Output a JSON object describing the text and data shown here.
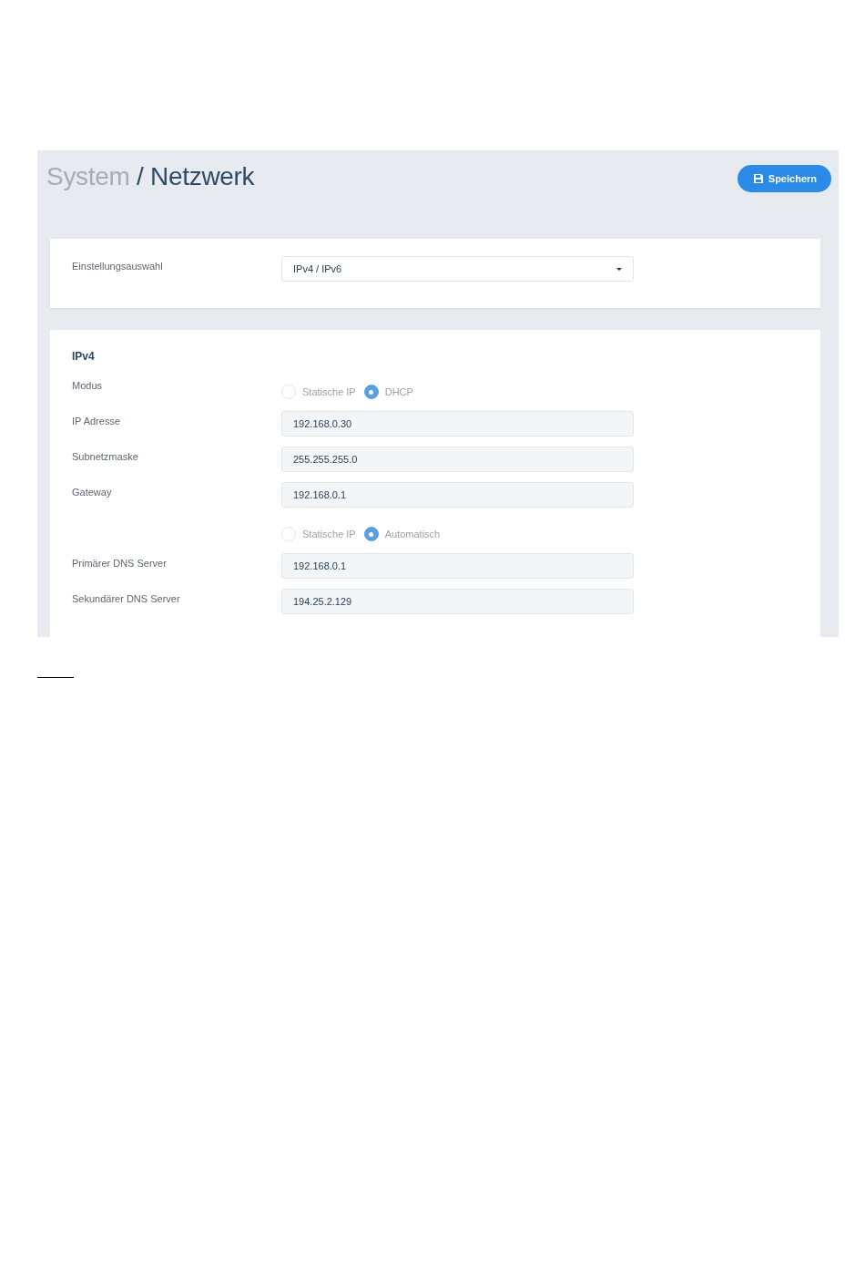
{
  "header": {
    "title_parent": "System",
    "title_current": "/ Netzwerk",
    "save_button": "Speichern"
  },
  "settings_card": {
    "label": "Einstellungsauswahl",
    "select_value": "IPv4 / IPv6"
  },
  "ipv4_card": {
    "heading": "IPv4",
    "rows": [
      {
        "kind": "radio",
        "label": "Modus",
        "options": [
          {
            "label": "Statische IP",
            "selected": false
          },
          {
            "label": "DHCP",
            "selected": true
          }
        ]
      },
      {
        "kind": "field",
        "label": "IP Adresse",
        "value": "192.168.0.30"
      },
      {
        "kind": "field",
        "label": "Subnetzmaske",
        "value": "255.255.255.0"
      },
      {
        "kind": "field",
        "label": "Gateway",
        "value": "192.168.0.1"
      },
      {
        "kind": "radio",
        "options": [
          {
            "label": "Statische IP",
            "selected": false
          },
          {
            "label": "Automatisch",
            "selected": true
          }
        ]
      },
      {
        "kind": "field",
        "label": "Primärer DNS Server",
        "value": "192.168.0.1"
      },
      {
        "kind": "field",
        "label": "Sekundärer DNS Server",
        "value": "194.25.2.129"
      }
    ]
  }
}
